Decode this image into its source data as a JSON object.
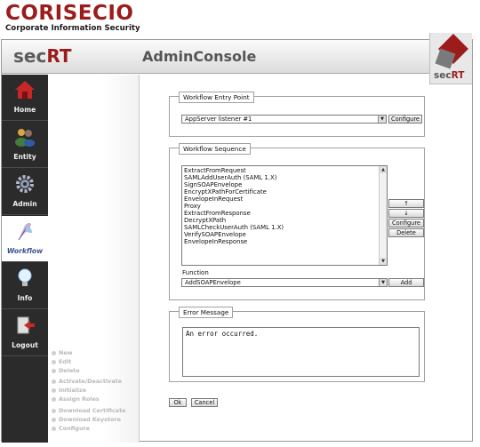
{
  "brand": {
    "name": "CORISECIO",
    "tagline": "Corporate Information Security"
  },
  "header": {
    "product_prefix": "sec",
    "product_suffix": "RT",
    "title": "AdminConsole",
    "logo_prefix": "sec",
    "logo_suffix": "RT"
  },
  "nav": [
    {
      "label": "Home",
      "icon": "home-icon"
    },
    {
      "label": "Entity",
      "icon": "users-icon"
    },
    {
      "label": "Admin",
      "icon": "gear-icon"
    },
    {
      "label": "Workflow",
      "icon": "feather-icon",
      "active": true
    },
    {
      "label": "Info",
      "icon": "lightbulb-icon"
    },
    {
      "label": "Logout",
      "icon": "logout-icon"
    }
  ],
  "actions": {
    "group1": [
      "New",
      "Edit",
      "Delete"
    ],
    "group2": [
      "Activate/Deactivate",
      "Initialize",
      "Assign Roles"
    ],
    "group3": [
      "Download Certificate",
      "Download Keystore",
      "Configure"
    ]
  },
  "entry_point": {
    "legend": "Workflow Entry Point",
    "selected": "AppServer listener #1",
    "configure_label": "Configure"
  },
  "sequence": {
    "legend": "Workflow Sequence",
    "items": [
      "ExtractFromRequest",
      "SAMLAddUserAuth (SAML 1.X)",
      "SignSOAPEnvelope",
      "EncryptXPathForCertificate",
      "EnvelopeInRequest",
      "Proxy",
      "ExtractFromResponse",
      "DecryptXPath",
      "SAMLCheckUserAuth (SAML 1.X)",
      "VerifySOAPEnvelope",
      "EnvelopeInResponse"
    ],
    "up_label": "↑",
    "down_label": "↓",
    "configure_label": "Configure",
    "delete_label": "Delete",
    "function_label": "Function",
    "function_selected": "AddSOAPEnvelope",
    "add_label": "Add"
  },
  "error": {
    "legend": "Error Message",
    "message": "An error occurred."
  },
  "footer": {
    "ok_label": "Ok",
    "cancel_label": "Cancel"
  },
  "colors": {
    "brand_red": "#9c1c1c",
    "nav_dark": "#2b2b2b"
  }
}
